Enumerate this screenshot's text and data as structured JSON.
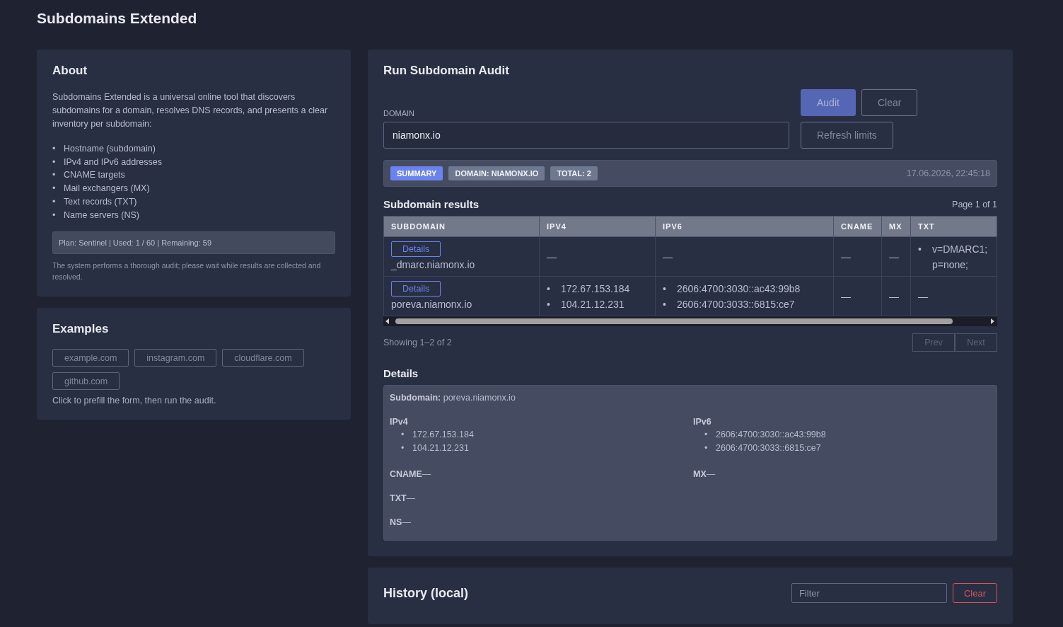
{
  "page_title": "Subdomains Extended",
  "bullet": "•",
  "about": {
    "title": "About",
    "intro": "Subdomains Extended is a universal online tool that discovers subdomains for a domain, resolves DNS records, and presents a clear inventory per subdomain:",
    "features": [
      "Hostname (subdomain)",
      "IPv4 and IPv6 addresses",
      "CNAME targets",
      "Mail exchangers (MX)",
      "Text records (TXT)",
      "Name servers (NS)"
    ],
    "plan": "Plan: Sentinel | Used: 1 / 60 | Remaining: 59",
    "note": "The system performs a thorough audit; please wait while results are collected and resolved."
  },
  "examples": {
    "title": "Examples",
    "items": [
      "example.com",
      "instagram.com",
      "cloudflare.com",
      "github.com"
    ],
    "hint": "Click to prefill the form, then run the audit."
  },
  "audit": {
    "title": "Run Subdomain Audit",
    "domain_label": "DOMAIN",
    "domain_value": "niamonx.io",
    "buttons": {
      "audit": "Audit",
      "clear": "Clear",
      "refresh": "Refresh limits"
    },
    "summary": {
      "badges": [
        {
          "label": "SUMMARY",
          "kind": "primary"
        },
        {
          "label": "DOMAIN: NIAMONX.IO",
          "kind": "muted"
        },
        {
          "label": "TOTAL: 2",
          "kind": "muted"
        }
      ],
      "timestamp": "17.06.2026, 22:45:18"
    },
    "results_title": "Subdomain results",
    "page_info": "Page 1 of 1",
    "table": {
      "columns": [
        "SUBDOMAIN",
        "IPV4",
        "IPV6",
        "CNAME",
        "MX",
        "TXT"
      ],
      "rows": [
        {
          "button": "Details",
          "subdomain": "_dmarc.niamonx.io",
          "ipv4": [
            "—"
          ],
          "ipv6": [
            "—"
          ],
          "cname": "—",
          "mx": "—",
          "txt": [
            "v=DMARC1; p=none;"
          ]
        },
        {
          "button": "Details",
          "subdomain": "poreva.niamonx.io",
          "ipv4": [
            "172.67.153.184",
            "104.21.12.231"
          ],
          "ipv6": [
            "2606:4700:3030::ac43:99b8",
            "2606:4700:3033::6815:ce7"
          ],
          "cname": "—",
          "mx": "—",
          "txt": [
            "—"
          ]
        }
      ]
    },
    "showing": "Showing 1–2 of 2",
    "prev": "Prev",
    "next": "Next",
    "details_title": "Details",
    "details": {
      "subdomain_label": "Subdomain:",
      "subdomain": "poreva.niamonx.io",
      "ipv4_label": "IPv4",
      "ipv4": [
        "172.67.153.184",
        "104.21.12.231"
      ],
      "ipv6_label": "IPv6",
      "ipv6": [
        "2606:4700:3030::ac43:99b8",
        "2606:4700:3033::6815:ce7"
      ],
      "cname_label": "CNAME",
      "cname": "—",
      "mx_label": "MX",
      "mx": "—",
      "txt_label": "TXT",
      "txt": "—",
      "ns_label": "NS",
      "ns": "—"
    }
  },
  "history": {
    "title": "History (local)",
    "filter_placeholder": "Filter",
    "clear": "Clear"
  }
}
